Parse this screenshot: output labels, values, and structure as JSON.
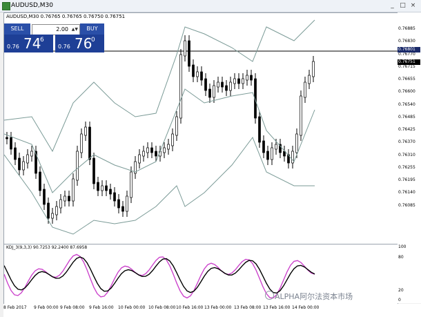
{
  "window": {
    "title": "AUDUSD,M30",
    "buttons": [
      "_",
      "□",
      "×"
    ]
  },
  "chart_header": "AUDUSD,M30  0.76765 0.76765 0.76750 0.76751",
  "one_click": {
    "sell_label": "SELL",
    "buy_label": "BUY",
    "lot": "2.00",
    "bid_small": "0.76",
    "bid_big": "74",
    "bid_sup": "6",
    "ask_small": "0.76",
    "ask_big": "76",
    "ask_sup": "0",
    "sell_color": "#2a4fa8",
    "buy_color": "#2a4fa8"
  },
  "price_axis": [
    "0.76885",
    "0.76830",
    "0.76770",
    "0.76715",
    "0.76655",
    "0.76600",
    "0.76540",
    "0.76485",
    "0.76425",
    "0.76370",
    "0.76310",
    "0.76255",
    "0.76195",
    "0.76140",
    "0.76085"
  ],
  "price_tags": {
    "line": "0.76801",
    "bid": "0.76751"
  },
  "indicator": {
    "header": "KDJ_3(9,3,3) 90.7253 92.2400 87.6958",
    "levels": [
      "100",
      "80",
      "20",
      "0"
    ]
  },
  "time_axis": [
    "8 Feb 2017",
    "9 Feb 00:00",
    "9 Feb 08:00",
    "9 Feb 16:00",
    "10 Feb 00:00",
    "10 Feb 08:00",
    "10 Feb 16:00",
    "13 Feb 00:00",
    "13 Feb 08:00",
    "13 Feb 16:00",
    "14 Feb 00:00"
  ],
  "watermark": "ALPHA阿尔法资本市场",
  "colors": {
    "bands": "#7a9a96",
    "hline": "#000000",
    "k": "#cc44cc",
    "d": "#000000",
    "candle": "#000000"
  }
}
